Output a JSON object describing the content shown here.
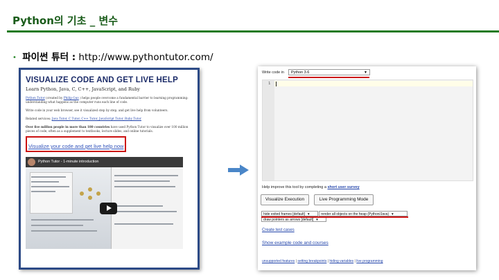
{
  "slide": {
    "title": "Python의 기초 _ 변수",
    "subtitle_bullet": "•",
    "subtitle_label": "파이썬 튜터 :",
    "subtitle_url": "http://www.pythontutor.com/"
  },
  "left_screenshot": {
    "heading": "VISUALIZE CODE AND GET LIVE HELP",
    "sublines": "Learn Python, Java, C, C++, JavaScript, and Ruby",
    "para1_link": "Python Tutor",
    "para1_mid": "(created by",
    "para1_author": "Philip Guo",
    "para1_rest": ") helps people overcome a fundamental barrier to learning programming: understanding what happens as the computer runs each line of code.",
    "para2": "Write code in your web browser, see it visualized step by step, and get live help from volunteers.",
    "para3_label": "Related services:",
    "para3_links": "Java Tutor, C Tutor, C++ Tutor, JavaScript Tutor, Ruby Tutor",
    "para4_bold": "Over five million people in more than 180 countries",
    "para4_rest": "have used Python Tutor to visualize over 100 million pieces of code, often as a supplement to textbooks, lecture slides, and online tutorials.",
    "cta_link": "Visualize your code and get live help now",
    "video_title": "Python Tutor - 1-minute introduction",
    "accent_border": "#cc1111"
  },
  "right_screenshot": {
    "write_code_label": "Write code in",
    "language_selected": "Python 3.6",
    "line_number": "1",
    "help_text": "Help improve this tool by completing a",
    "survey_link": "short user survey",
    "visualize_button": "Visualize Execution",
    "live_mode_button": "Live Programming Mode",
    "option_frames": "hide exited frames [default]",
    "option_heap": "render all objects on the heap (Python/Java)",
    "option_pointers": "draw pointers as arrows [default]",
    "create_test_cases": "Create test cases",
    "show_example": "Show example code and courses",
    "footer": {
      "unsupported": "unsupported features",
      "breakpoints": "setting breakpoints",
      "hiding": "hiding variables",
      "live": "live programming",
      "separator": " | "
    }
  },
  "icons": {
    "arrow": "right-arrow-icon",
    "dropdown": "chevron-down-icon",
    "play": "play-icon"
  },
  "colors": {
    "title_green": "#1a5c1a",
    "rule_green": "#1f7a1f",
    "highlight_red": "#cc1111",
    "frame_blue": "#2c4a86",
    "arrow_blue": "#4a86c8",
    "link_blue": "#2244aa"
  }
}
